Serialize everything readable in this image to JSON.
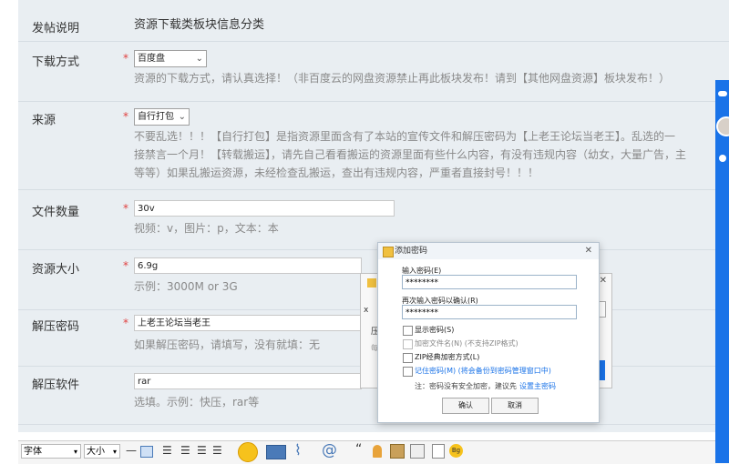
{
  "form": {
    "section_label": "发帖说明",
    "section_value": "资源下载类板块信息分类",
    "download_label": "下载方式",
    "download_select": "百度盘",
    "download_hint": "资源的下载方式，请认真选择！（非百度云的网盘资源禁止再此板块发布！请到【其他网盘资源】板块发布！）",
    "source_label": "来源",
    "source_select": "自行打包",
    "source_hint_1": "不要乱选！！！【自行打包】是指资源里面含有了本站的宣传文件和解压密码为【上老王论坛当老王】。乱选的一",
    "source_hint_2": "接禁言一个月！【转载搬运】，请先自己看看搬运的资源里面有些什么内容，有没有违规内容（幼女，大量广告，主",
    "source_hint_3": "等等）如果乱搬运资源，未经检查乱搬运，查出有违规内容，严重者直接封号！！！",
    "count_label": "文件数量",
    "count_value": "30v",
    "count_hint": "视频：v，图片：p，文本：本",
    "size_label": "资源大小",
    "size_value": "6.9g",
    "size_hint": "示例：3000M or 3G",
    "password_label": "解压密码",
    "password_value": "上老王论坛当老王",
    "password_hint": "如果解压密码，请填写，没有就填：无",
    "software_label": "解压软件",
    "software_value": "rar",
    "software_hint": "选填。示例：快压，rar等",
    "required_mark": "*"
  },
  "toolbar": {
    "font_label": "字体",
    "size_label": "大小",
    "quote_mark": "“",
    "bg_label": "Bg"
  },
  "dialog": {
    "title": "添加密码",
    "close": "✕",
    "enter_label": "输入密码(E)",
    "enter_value": "********",
    "confirm_label": "再次输入密码以确认(R)",
    "confirm_value": "********",
    "show_password": "显示密码(S)",
    "encrypt_names": "加密文件名(N) (不支持ZIP格式)",
    "zip_classic": "ZIP经典加密方式(L)",
    "remember_password": "记住密码(M) (将会备份到密码管理窗口中)",
    "note": "注：密码没有安全加密，建议先",
    "note_link": "设置主密码",
    "ok_button": "确认",
    "cancel_button": "取消"
  },
  "back_dialog": {
    "close": "✕",
    "fragment_x": "x",
    "fragment_ya": "压",
    "fragment_mei": "每"
  },
  "colors": {
    "form_bg": "#e9eef2",
    "required": "#e04040",
    "hint": "#8a8a8a",
    "link": "#1a73e8",
    "side_bar": "#1a73e8"
  }
}
